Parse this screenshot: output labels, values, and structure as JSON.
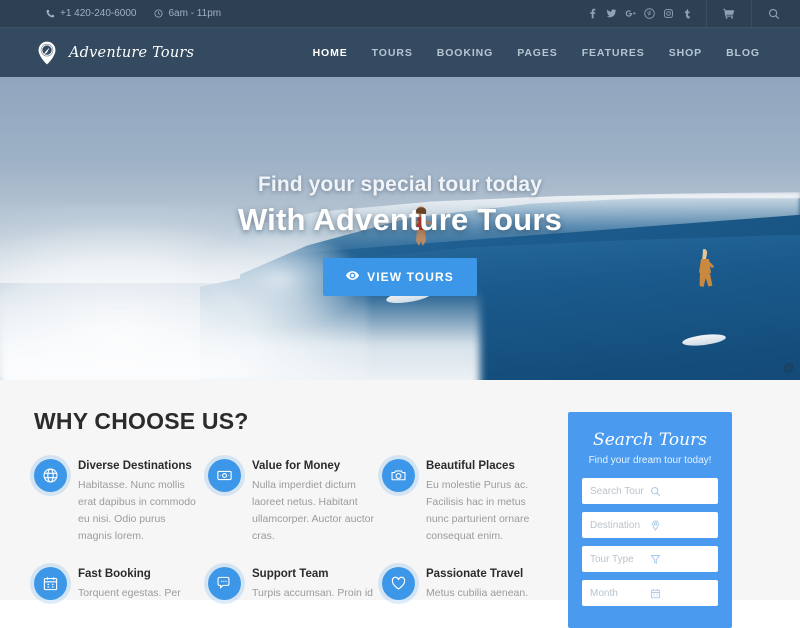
{
  "topbar": {
    "phone": "+1 420-240-6000",
    "hours": "6am - 11pm",
    "phone_icon": "phone-icon",
    "clock_icon": "clock-icon",
    "social": [
      {
        "name": "facebook-icon",
        "glyph": "f"
      },
      {
        "name": "twitter-icon",
        "glyph": "t"
      },
      {
        "name": "google-plus-icon",
        "glyph": "g"
      },
      {
        "name": "pinterest-icon",
        "glyph": "p"
      },
      {
        "name": "instagram-icon",
        "glyph": "i"
      },
      {
        "name": "tumblr-icon",
        "glyph": "t"
      }
    ],
    "cart_icon": "cart-icon",
    "search_icon": "search-icon"
  },
  "header": {
    "brand": "Adventure Tours",
    "logo_icon": "compass-pin-icon",
    "nav": [
      {
        "label": "HOME",
        "active": true
      },
      {
        "label": "TOURS",
        "active": false
      },
      {
        "label": "BOOKING",
        "active": false
      },
      {
        "label": "PAGES",
        "active": false
      },
      {
        "label": "FEATURES",
        "active": false
      },
      {
        "label": "SHOP",
        "active": false
      },
      {
        "label": "BLOG",
        "active": false
      }
    ]
  },
  "hero": {
    "subheading": "Find your special tour today",
    "heading": "With Adventure Tours",
    "cta_label": "VIEW TOURS",
    "cta_icon": "eye-icon",
    "watermark": "@",
    "accent_color": "#3d97e8"
  },
  "main": {
    "section_title": "WHY CHOOSE US?",
    "features": [
      {
        "icon": "globe-icon",
        "title": "Diverse Destinations",
        "desc": "Habitasse. Nunc mollis erat dapibus in commodo eu nisi. Odio purus magnis lorem."
      },
      {
        "icon": "money-icon",
        "title": "Value for Money",
        "desc": "Nulla imperdiet dictum laoreet netus. Habitant ullamcorper. Auctor auctor cras."
      },
      {
        "icon": "camera-icon",
        "title": "Beautiful Places",
        "desc": "Eu molestie Purus ac. Facilisis hac in metus nunc parturient ornare consequat enim."
      },
      {
        "icon": "calendar-icon",
        "title": "Fast Booking",
        "desc": "Torquent egestas. Per"
      },
      {
        "icon": "chat-icon",
        "title": "Support Team",
        "desc": "Turpis accumsan. Proin id"
      },
      {
        "icon": "heart-icon",
        "title": "Passionate Travel",
        "desc": "Metus cubilia aenean."
      }
    ]
  },
  "search_panel": {
    "title": "Search Tours",
    "subtitle": "Find your dream tour today!",
    "panel_color": "#4a9bf0",
    "fields": [
      {
        "placeholder": "Search Tour",
        "icon": "search-icon"
      },
      {
        "placeholder": "Destination",
        "icon": "map-marker-icon"
      },
      {
        "placeholder": "Tour Type",
        "icon": "filter-icon"
      },
      {
        "placeholder": "Month",
        "icon": "calendar-icon"
      }
    ]
  }
}
